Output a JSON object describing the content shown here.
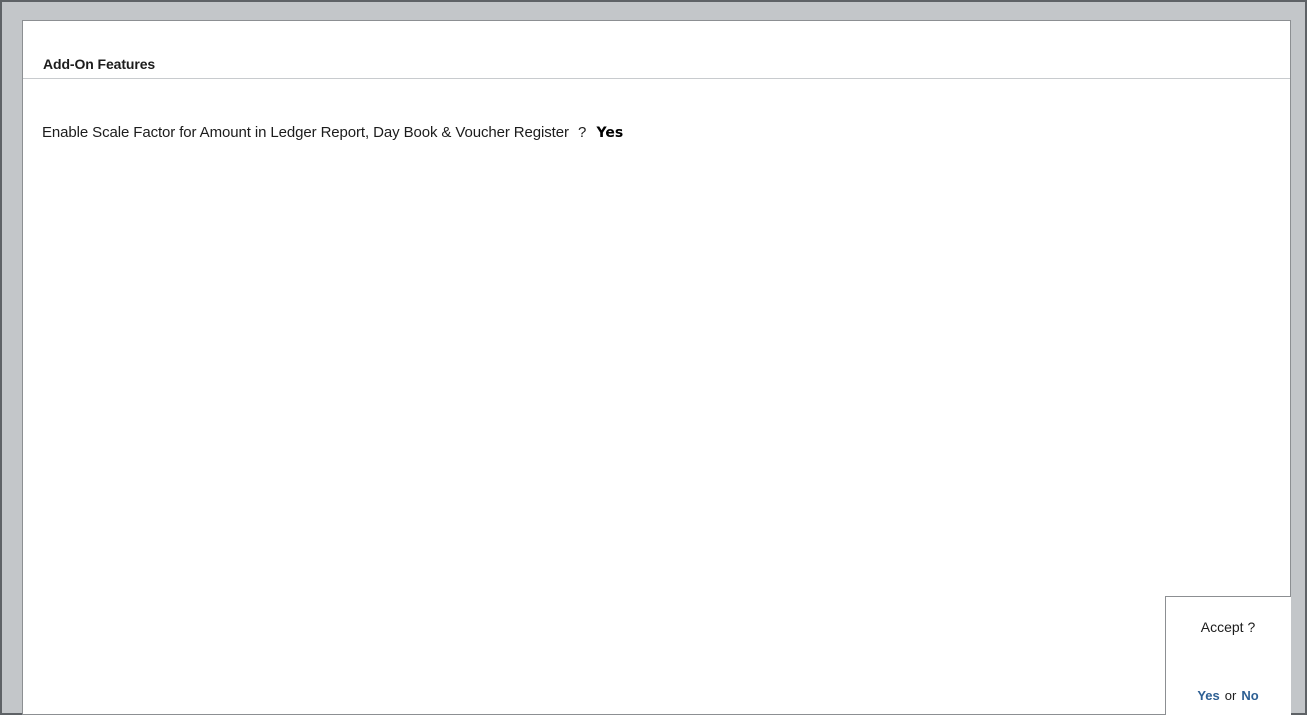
{
  "header": {
    "title": "Add-On Features"
  },
  "question": {
    "label": "Enable Scale Factor for Amount in Ledger Report, Day Book & Voucher Register",
    "mark": "?",
    "value": "Yes"
  },
  "accept_prompt": {
    "question": "Accept ?",
    "yes_label": "Yes",
    "or_label": "or",
    "no_label": "No"
  },
  "colors": {
    "frame_background": "#c3c6c9",
    "panel_background": "#ffffff",
    "option_accent": "#2d5f93"
  }
}
